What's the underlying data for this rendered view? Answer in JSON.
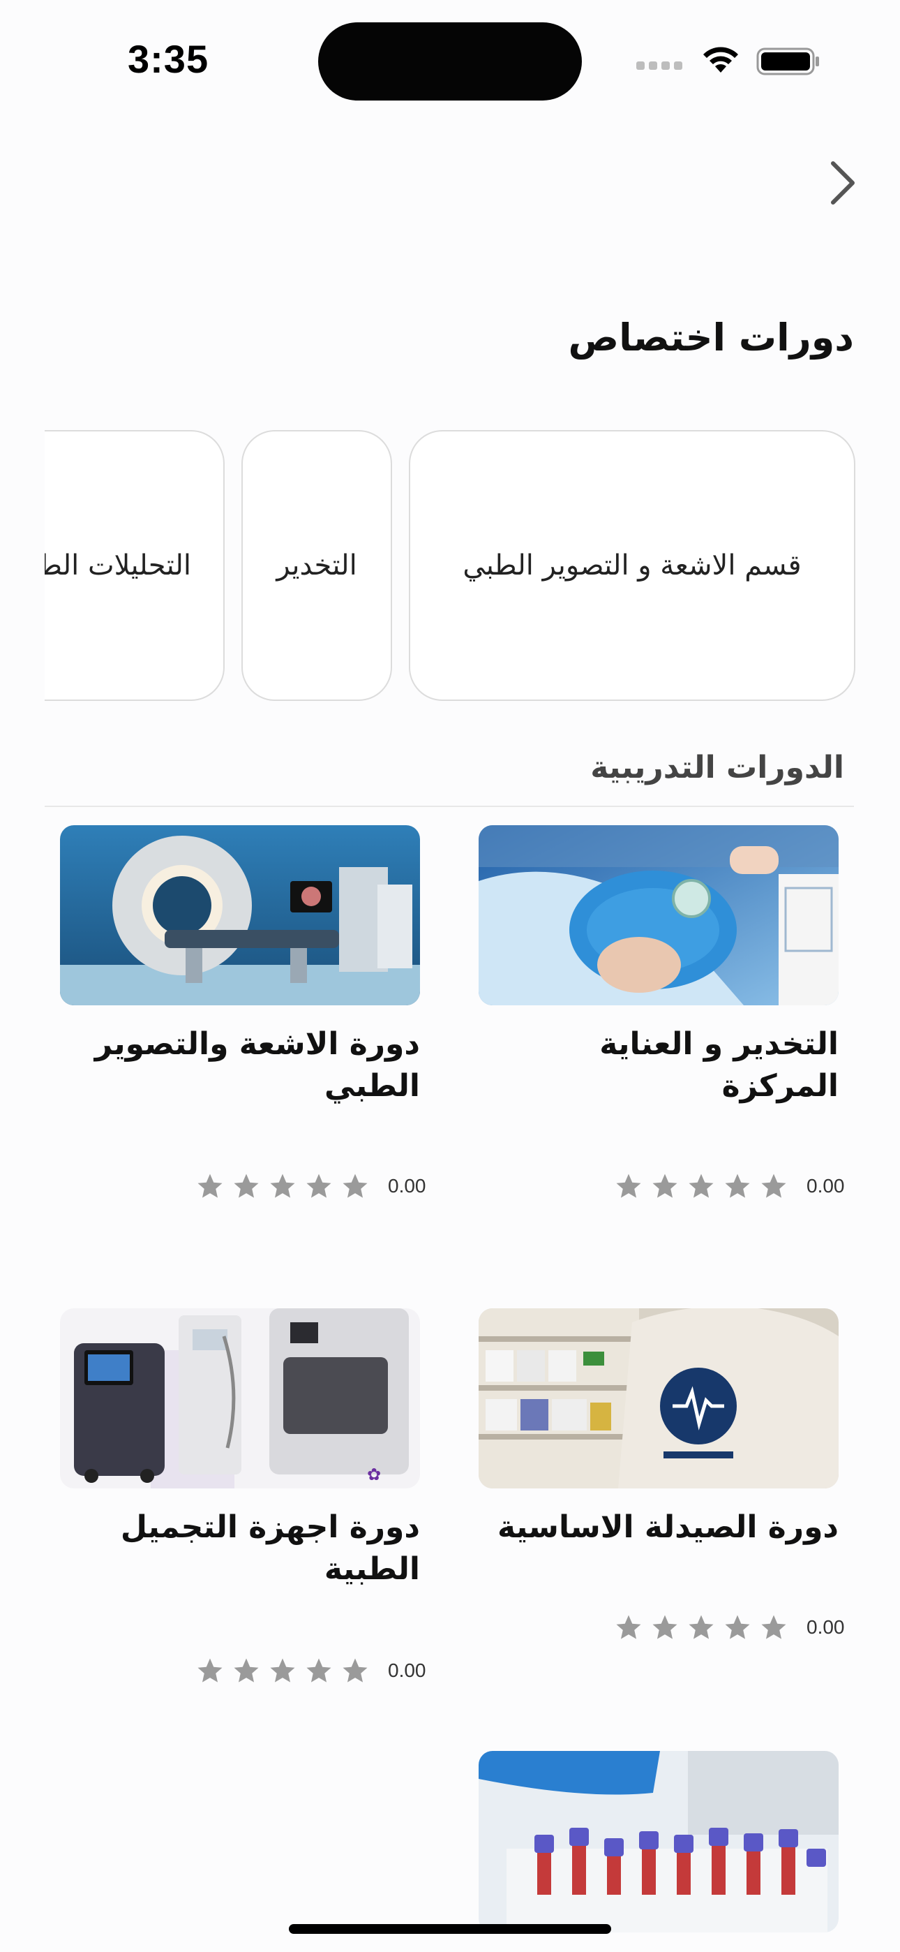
{
  "status_bar": {
    "time": "3:35"
  },
  "header": {
    "section_title": "دورات اختصاص"
  },
  "categories": [
    {
      "label": "قسم الاشعة و التصوير الطبي"
    },
    {
      "label": "التخدير"
    },
    {
      "label": "التحليلات الطبية"
    }
  ],
  "training": {
    "header": "الدورات التدريبية"
  },
  "courses": [
    {
      "title": "التخدير و العناية المركزة",
      "rating": "0.00",
      "image": "anesthesia-photo"
    },
    {
      "title": "دورة الاشعة والتصوير الطبي",
      "rating": "0.00",
      "image": "mri-scanner-photo"
    },
    {
      "title": "دورة الصيدلة الاساسية",
      "rating": "0.00",
      "image": "pharmacy-photo"
    },
    {
      "title": "دورة اجهزة التجميل الطبية",
      "rating": "0.00",
      "image": "cosmetic-devices-photo"
    },
    {
      "title": "",
      "rating": "",
      "image": "lab-blood-tubes-photo"
    }
  ],
  "colors": {
    "star": "#9a9a9a",
    "card_border": "#dcdcdc",
    "accent_blue": "#2a7fd0"
  }
}
